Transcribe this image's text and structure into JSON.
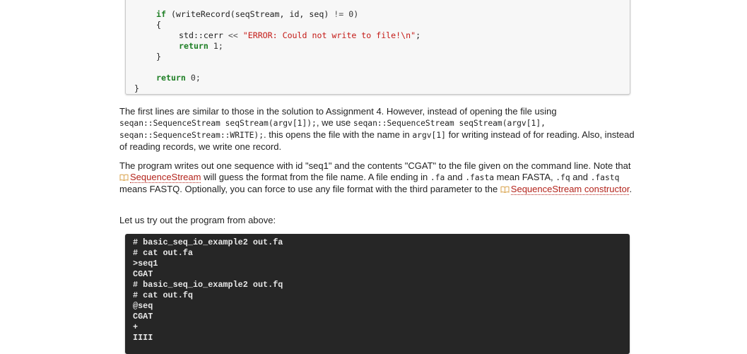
{
  "code_block": {
    "if_kw": "if",
    "if_cond": " (writeRecord(seqStream, id, seq) ",
    "if_op": "!=",
    "if_tail": " 0)",
    "open_brace": "{",
    "cerr_prefix": "std::cerr ",
    "cerr_op": "<<",
    "cerr_string": " \"ERROR: Could not write to file!\\n\"",
    "cerr_tail": ";",
    "return1_kw": "return",
    "return1_tail": " 1;",
    "close_brace": "}",
    "return0_kw": "return",
    "return0_tail": " 0;",
    "func_close": "}"
  },
  "paragraph1": {
    "t1": "The first lines are similar to those in the solution to Assignment 4. However, instead of opening the file using",
    "c1": "seqan::SequenceStream seqStream(argv[1]);",
    "t2": ", we use ",
    "c2": "seqan::SequenceStream seqStream(argv[1],",
    "c3": "seqan::SequenceStream::WRITE);",
    "t3": ". this opens the file with the name in ",
    "c4": "argv[1]",
    "t4": " for writing instead of for reading. Also, instead of reading records, we write one record."
  },
  "paragraph2": {
    "t1": "The program writes out one sequence with id \"seq1\" and the contents \"CGAT\" to the file given on the command line. Note that ",
    "link1": "SequenceStream",
    "t2": " will guess the format from the file name. A file ending in ",
    "c1": ".fa",
    "t3": " and ",
    "c2": ".fasta",
    "t4": " mean FASTA, ",
    "c3": ".fq",
    "t5": " and ",
    "c4": ".fastq",
    "t6": " means FASTQ. Optionally, you can force to use any file format with the third parameter to the ",
    "link2": "SequenceStream constructor",
    "t7": "."
  },
  "paragraph3": {
    "text": "Let us try out the program from above:"
  },
  "terminal": {
    "lines": [
      "# basic_seq_io_example2 out.fa",
      "# cat out.fa",
      ">seq1",
      "CGAT",
      "# basic_seq_io_example2 out.fq",
      "# cat out.fq",
      "@seq",
      "CGAT",
      "+",
      "IIII"
    ]
  },
  "icons": {
    "doc_link": "book-icon"
  }
}
